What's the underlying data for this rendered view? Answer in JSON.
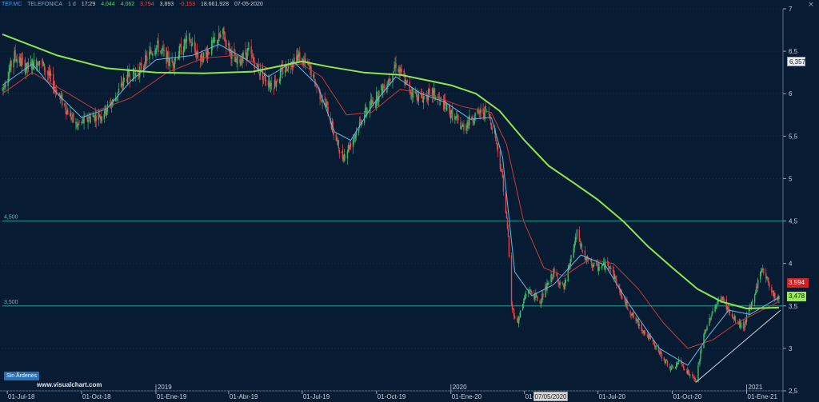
{
  "header": {
    "symbol": "TEF.MC",
    "name": "TELEFONICA",
    "period": "1 d",
    "time": "17:29",
    "open": "4,044",
    "high": "4,062",
    "low": "3,794",
    "close": "3,893",
    "change": "-0,153",
    "volume": "18.661.928",
    "date": "07-05-2020"
  },
  "overlays": {
    "no_orders": "Sin Ãrdenes",
    "watermark": "www.visualchart.com",
    "date_cursor": "07/05/2020",
    "last_price_tag": "6,357",
    "close_tag": "3,594",
    "green_ma_tag": "3,478"
  },
  "colors": {
    "background": "#071c33",
    "grid": "#12304d",
    "candle_up": "#3dbb66",
    "candle_down": "#e64848",
    "ma_fast": "#5fbdea",
    "ma_mid": "#c83a3a",
    "ma_slow": "#8ee64e",
    "horizontal_line": "#1f8a7f",
    "trendline": "#cfd8e0"
  },
  "chart_data": {
    "type": "candlestick",
    "y_axis": {
      "range": [
        2.5,
        7.0
      ],
      "ticks": [
        2.5,
        3,
        3.5,
        4,
        4.5,
        5,
        5.5,
        6,
        6.5,
        7
      ],
      "tick_labels": [
        "2,5",
        "3",
        "3,5",
        "4",
        "4,5",
        "5",
        "5,5",
        "6",
        "6,5",
        "7"
      ],
      "position": "right"
    },
    "x_axis": {
      "start": "2018-06-25",
      "end": "2021-02-15",
      "tick_dates": [
        "2018-07-01",
        "2018-10-01",
        "2019-01-01",
        "2019-04-01",
        "2019-07-01",
        "2019-10-01",
        "2020-01-01",
        "2020-04-01",
        "2020-07-01",
        "2020-10-01",
        "2021-01-01"
      ],
      "tick_labels": [
        "01-Jul-18",
        "01-Oct-18",
        "01-Ene-19",
        "01-Abr-19",
        "01-Jul-19",
        "01-Oct-19",
        "01-Ene-20",
        "01-Abr-20",
        "01-Jul-20",
        "01-Oct-20",
        "01-Ene-21"
      ],
      "year_dates": [
        "2019-01-01",
        "2020-01-01",
        "2021-01-01"
      ],
      "year_labels": [
        "2019",
        "2020",
        "2021"
      ]
    },
    "horizontal_lines": [
      {
        "value": 4.5,
        "label": "4,500"
      },
      {
        "value": 3.5,
        "label": "3,500"
      }
    ],
    "price_path": [
      [
        "2018-06-25",
        6.05
      ],
      [
        "2018-07-10",
        6.45
      ],
      [
        "2018-07-25",
        6.3
      ],
      [
        "2018-08-10",
        6.4
      ],
      [
        "2018-08-25",
        6.15
      ],
      [
        "2018-09-10",
        5.85
      ],
      [
        "2018-09-25",
        5.62
      ],
      [
        "2018-10-10",
        5.72
      ],
      [
        "2018-10-25",
        5.75
      ],
      [
        "2018-11-10",
        5.92
      ],
      [
        "2018-11-25",
        6.2
      ],
      [
        "2018-12-10",
        6.25
      ],
      [
        "2019-01-01",
        6.58
      ],
      [
        "2019-01-20",
        6.35
      ],
      [
        "2019-02-10",
        6.65
      ],
      [
        "2019-02-25",
        6.4
      ],
      [
        "2019-03-10",
        6.55
      ],
      [
        "2019-03-25",
        6.7
      ],
      [
        "2019-04-10",
        6.35
      ],
      [
        "2019-04-25",
        6.5
      ],
      [
        "2019-05-10",
        6.25
      ],
      [
        "2019-05-25",
        6.1
      ],
      [
        "2019-06-10",
        6.3
      ],
      [
        "2019-06-25",
        6.45
      ],
      [
        "2019-07-10",
        6.3
      ],
      [
        "2019-07-20",
        6.05
      ],
      [
        "2019-07-31",
        5.85
      ],
      [
        "2019-08-10",
        5.5
      ],
      [
        "2019-08-20",
        5.25
      ],
      [
        "2019-09-01",
        5.45
      ],
      [
        "2019-09-15",
        5.75
      ],
      [
        "2019-09-30",
        5.95
      ],
      [
        "2019-10-15",
        6.15
      ],
      [
        "2019-10-25",
        6.35
      ],
      [
        "2019-11-10",
        6.05
      ],
      [
        "2019-11-25",
        5.95
      ],
      [
        "2019-12-10",
        6.0
      ],
      [
        "2019-12-25",
        5.85
      ],
      [
        "2020-01-15",
        5.6
      ],
      [
        "2020-01-31",
        5.75
      ],
      [
        "2020-02-15",
        5.8
      ],
      [
        "2020-02-25",
        5.5
      ],
      [
        "2020-03-05",
        5.0
      ],
      [
        "2020-03-12",
        4.3
      ],
      [
        "2020-03-16",
        3.5
      ],
      [
        "2020-03-23",
        3.3
      ],
      [
        "2020-04-05",
        3.7
      ],
      [
        "2020-04-20",
        3.55
      ],
      [
        "2020-05-07",
        3.89
      ],
      [
        "2020-05-20",
        3.7
      ],
      [
        "2020-06-05",
        4.35
      ],
      [
        "2020-06-15",
        4.05
      ],
      [
        "2020-06-30",
        3.95
      ],
      [
        "2020-07-15",
        4.0
      ],
      [
        "2020-07-31",
        3.6
      ],
      [
        "2020-08-15",
        3.35
      ],
      [
        "2020-08-31",
        3.15
      ],
      [
        "2020-09-15",
        2.95
      ],
      [
        "2020-09-30",
        2.75
      ],
      [
        "2020-10-10",
        2.85
      ],
      [
        "2020-10-20",
        2.72
      ],
      [
        "2020-10-30",
        2.62
      ],
      [
        "2020-11-09",
        3.15
      ],
      [
        "2020-11-20",
        3.45
      ],
      [
        "2020-12-01",
        3.6
      ],
      [
        "2020-12-15",
        3.35
      ],
      [
        "2020-12-28",
        3.25
      ],
      [
        "2021-01-08",
        3.55
      ],
      [
        "2021-01-20",
        3.95
      ],
      [
        "2021-02-05",
        3.6
      ],
      [
        "2021-02-10",
        3.59
      ]
    ],
    "ma_fast": [
      [
        "2018-06-25",
        6.1
      ],
      [
        "2018-08-01",
        6.35
      ],
      [
        "2018-09-01",
        6.0
      ],
      [
        "2018-10-01",
        5.72
      ],
      [
        "2018-11-01",
        5.82
      ],
      [
        "2018-12-01",
        6.15
      ],
      [
        "2019-01-01",
        6.4
      ],
      [
        "2019-02-15",
        6.45
      ],
      [
        "2019-03-20",
        6.58
      ],
      [
        "2019-04-20",
        6.42
      ],
      [
        "2019-05-20",
        6.2
      ],
      [
        "2019-06-20",
        6.38
      ],
      [
        "2019-07-20",
        6.1
      ],
      [
        "2019-08-10",
        5.55
      ],
      [
        "2019-08-30",
        5.45
      ],
      [
        "2019-09-25",
        5.85
      ],
      [
        "2019-10-25",
        6.2
      ],
      [
        "2019-11-25",
        6.0
      ],
      [
        "2019-12-25",
        5.9
      ],
      [
        "2020-01-25",
        5.7
      ],
      [
        "2020-02-20",
        5.72
      ],
      [
        "2020-03-05",
        5.25
      ],
      [
        "2020-03-20",
        3.9
      ],
      [
        "2020-04-10",
        3.62
      ],
      [
        "2020-05-07",
        3.75
      ],
      [
        "2020-06-10",
        4.1
      ],
      [
        "2020-07-10",
        3.98
      ],
      [
        "2020-08-10",
        3.5
      ],
      [
        "2020-09-15",
        3.0
      ],
      [
        "2020-10-20",
        2.8
      ],
      [
        "2020-11-15",
        3.15
      ],
      [
        "2020-12-10",
        3.45
      ],
      [
        "2021-01-05",
        3.4
      ],
      [
        "2021-02-10",
        3.6
      ]
    ],
    "ma_mid": [
      [
        "2018-06-25",
        6.0
      ],
      [
        "2018-08-01",
        6.25
      ],
      [
        "2018-09-15",
        6.0
      ],
      [
        "2018-10-20",
        5.8
      ],
      [
        "2018-12-01",
        5.95
      ],
      [
        "2019-01-15",
        6.25
      ],
      [
        "2019-03-01",
        6.42
      ],
      [
        "2019-04-10",
        6.45
      ],
      [
        "2019-05-20",
        6.3
      ],
      [
        "2019-06-30",
        6.35
      ],
      [
        "2019-07-25",
        6.2
      ],
      [
        "2019-08-25",
        5.75
      ],
      [
        "2019-09-25",
        5.78
      ],
      [
        "2019-10-30",
        6.05
      ],
      [
        "2019-12-01",
        6.0
      ],
      [
        "2020-01-15",
        5.85
      ],
      [
        "2020-02-20",
        5.78
      ],
      [
        "2020-03-10",
        5.4
      ],
      [
        "2020-03-31",
        4.5
      ],
      [
        "2020-04-25",
        3.95
      ],
      [
        "2020-05-20",
        3.85
      ],
      [
        "2020-06-20",
        4.05
      ],
      [
        "2020-07-20",
        4.0
      ],
      [
        "2020-08-20",
        3.7
      ],
      [
        "2020-09-20",
        3.3
      ],
      [
        "2020-10-20",
        3.0
      ],
      [
        "2020-11-20",
        3.1
      ],
      [
        "2020-12-20",
        3.3
      ],
      [
        "2021-01-20",
        3.45
      ],
      [
        "2021-02-10",
        3.55
      ]
    ],
    "ma_slow": [
      [
        "2018-06-25",
        6.7
      ],
      [
        "2018-09-01",
        6.45
      ],
      [
        "2018-11-01",
        6.3
      ],
      [
        "2019-01-01",
        6.25
      ],
      [
        "2019-03-01",
        6.24
      ],
      [
        "2019-05-01",
        6.26
      ],
      [
        "2019-07-01",
        6.38
      ],
      [
        "2019-08-01",
        6.32
      ],
      [
        "2019-09-15",
        6.25
      ],
      [
        "2019-11-01",
        6.22
      ],
      [
        "2020-01-01",
        6.1
      ],
      [
        "2020-02-01",
        6.0
      ],
      [
        "2020-03-01",
        5.8
      ],
      [
        "2020-04-01",
        5.45
      ],
      [
        "2020-05-01",
        5.15
      ],
      [
        "2020-06-01",
        4.95
      ],
      [
        "2020-07-01",
        4.75
      ],
      [
        "2020-08-01",
        4.5
      ],
      [
        "2020-09-01",
        4.2
      ],
      [
        "2020-10-01",
        3.95
      ],
      [
        "2020-11-01",
        3.7
      ],
      [
        "2020-12-01",
        3.55
      ],
      [
        "2021-01-01",
        3.47
      ],
      [
        "2021-02-10",
        3.48
      ]
    ],
    "trendline": [
      [
        "2020-10-30",
        2.6
      ],
      [
        "2021-02-12",
        3.45
      ]
    ]
  }
}
